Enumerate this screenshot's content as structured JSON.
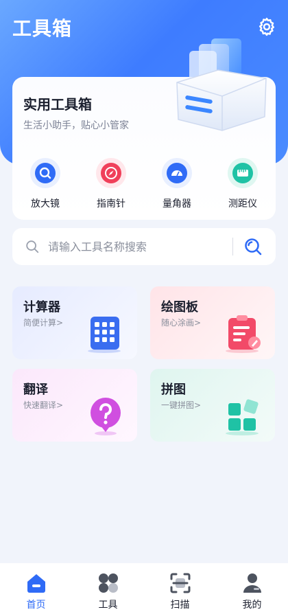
{
  "header": {
    "title": "工具箱",
    "settings_icon": "gear-icon"
  },
  "hero": {
    "title": "实用工具箱",
    "subtitle": "生活小助手，贴心小管家",
    "quick_tools": [
      {
        "label": "放大镜",
        "icon": "magnifier-icon",
        "color": "#2f6bf6"
      },
      {
        "label": "指南针",
        "icon": "compass-icon",
        "color": "#f0405a"
      },
      {
        "label": "量角器",
        "icon": "protractor-icon",
        "color": "#2f6bf6"
      },
      {
        "label": "测距仪",
        "icon": "ruler-icon",
        "color": "#1fc2a5"
      }
    ]
  },
  "search": {
    "placeholder": "请输入工具名称搜索"
  },
  "tools": [
    {
      "title": "计算器",
      "subtitle": "简便计算>",
      "icon": "calculator-icon",
      "color": "#3a6df0"
    },
    {
      "title": "绘图板",
      "subtitle": "随心涂画>",
      "icon": "drawing-board-icon",
      "color": "#f24a68"
    },
    {
      "title": "翻译",
      "subtitle": "快速翻译>",
      "icon": "question-bubble-icon",
      "color": "#d04fe0"
    },
    {
      "title": "拼图",
      "subtitle": "一键拼图>",
      "icon": "puzzle-grid-icon",
      "color": "#1fc2a5"
    }
  ],
  "tabbar": {
    "items": [
      {
        "label": "首页",
        "icon": "home-icon",
        "active": true
      },
      {
        "label": "工具",
        "icon": "grid-icon",
        "active": false
      },
      {
        "label": "扫描",
        "icon": "scan-icon",
        "active": false
      },
      {
        "label": "我的",
        "icon": "user-icon",
        "active": false
      }
    ]
  },
  "colors": {
    "primary": "#2f6bf6",
    "hero_bg": "#3e7cff"
  }
}
